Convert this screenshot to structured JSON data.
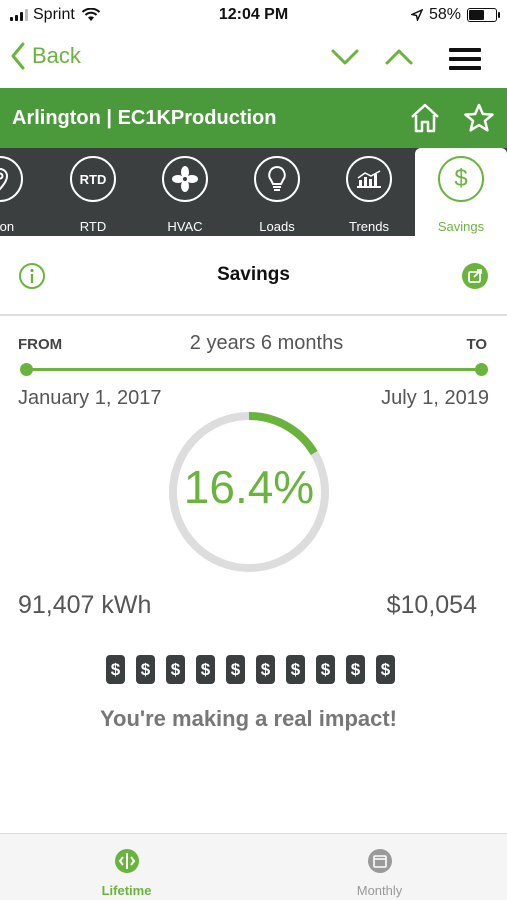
{
  "status_bar": {
    "carrier": "Sprint",
    "time": "12:04 PM",
    "battery_percent": "58%",
    "battery_level": 0.58
  },
  "nav": {
    "back_label": "Back"
  },
  "header": {
    "title": "Arlington | EC1KProduction"
  },
  "tabs": [
    {
      "label": "ation",
      "icon": "location-icon",
      "active": false
    },
    {
      "label": "RTD",
      "icon_text": "RTD",
      "icon": "refresh-icon",
      "active": false
    },
    {
      "label": "HVAC",
      "icon": "fan-icon",
      "active": false
    },
    {
      "label": "Loads",
      "icon": "lightbulb-icon",
      "active": false
    },
    {
      "label": "Trends",
      "icon": "chart-icon",
      "active": false
    },
    {
      "label": "Savings",
      "icon": "dollar-icon",
      "icon_text": "$",
      "active": true
    }
  ],
  "section": {
    "title": "Savings"
  },
  "range": {
    "from_label": "FROM",
    "to_label": "TO",
    "duration": "2 years 6 months",
    "from_date": "January 1, 2017",
    "to_date": "July 1, 2019"
  },
  "gauge": {
    "value_text": "16.4%",
    "fraction": 0.164
  },
  "savings": {
    "energy": "91,407 kWh",
    "money": "$10,054"
  },
  "dollar_chips": [
    "$",
    "$",
    "$",
    "$",
    "$",
    "$",
    "$",
    "$",
    "$",
    "$"
  ],
  "message": "You're making a real impact!",
  "bottom_tabs": [
    {
      "label": "Lifetime",
      "active": true
    },
    {
      "label": "Monthly",
      "active": false
    }
  ],
  "colors": {
    "accent": "#6ab43e",
    "header_green": "#4a9a3c",
    "tab_strip": "#3c3f40",
    "gauge_track": "#dddddd"
  }
}
